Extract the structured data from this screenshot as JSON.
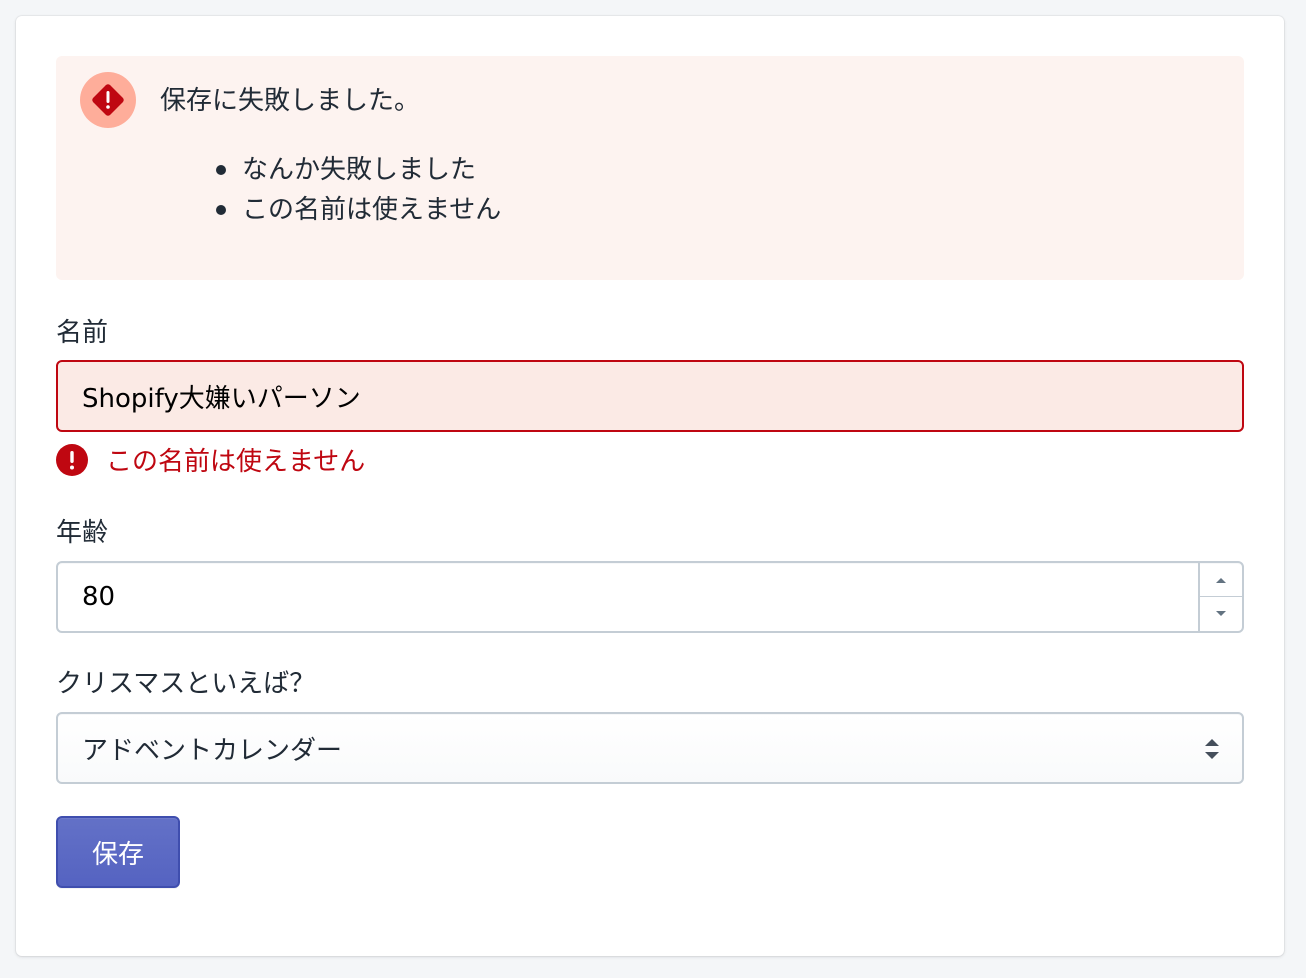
{
  "banner": {
    "title": "保存に失敗しました。",
    "errors": [
      "なんか失敗しました",
      "この名前は使えません"
    ]
  },
  "name_field": {
    "label": "名前",
    "value": "Shopify大嫌いパーソン",
    "error": "この名前は使えません"
  },
  "age_field": {
    "label": "年齢",
    "value": "80"
  },
  "christmas_field": {
    "label": "クリスマスといえば？",
    "selected": "アドベントカレンダー"
  },
  "save_button": {
    "label": "保存"
  },
  "colors": {
    "critical": "#bf0711",
    "banner_bg": "#fdf3f0",
    "field_error_bg": "#fbeae5",
    "primary": "#5c6ac4"
  },
  "icons": [
    "critical-diamond-icon",
    "alert-circle-icon",
    "caret-up-icon",
    "caret-down-icon",
    "select-arrows-icon"
  ]
}
